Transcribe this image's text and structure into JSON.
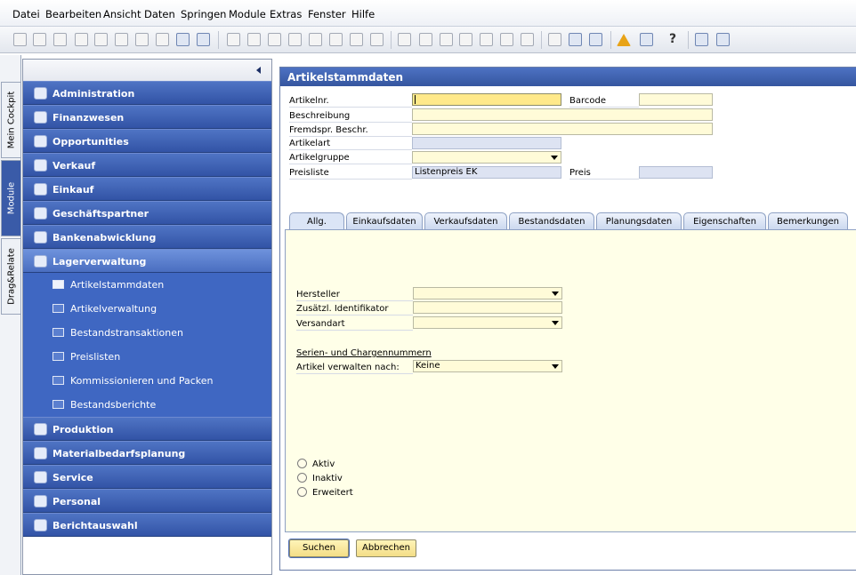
{
  "menu": [
    "Datei",
    "Bearbeiten",
    "Ansicht",
    "Daten",
    "Springen",
    "Module",
    "Extras",
    "Fenster",
    "Hilfe"
  ],
  "toolbar": {
    "icons": [
      "print-preview-icon",
      "print-icon",
      "send-icon",
      "excel-icon",
      "word-icon",
      "pdf-icon",
      "layout-icon",
      "navigate-icon",
      "lock-icon",
      "find-icon",
      "add-icon",
      "first-record-icon",
      "previous-record-icon",
      "next-record-icon",
      "last-record-icon",
      "filter-icon",
      "sort-icon",
      "base-document-icon",
      "target-document-icon",
      "relationship-map-icon",
      "payment-icon",
      "gross-profit-icon",
      "settlement-icon",
      "journal-icon",
      "edit-icon",
      "query-icon",
      "query-manager-icon",
      "alerts-icon",
      "calendar-icon",
      "help-icon",
      "form-settings-icon",
      "drag-relate-icon"
    ],
    "help_glyph": "?"
  },
  "side_tabs": [
    "Mein Cockpit",
    "Module",
    "Drag&Relate"
  ],
  "nav": {
    "modules_top": [
      "Administration",
      "Finanzwesen",
      "Opportunities",
      "Verkauf",
      "Einkauf",
      "Geschäftspartner",
      "Bankenabwicklung",
      "Lagerverwaltung"
    ],
    "sub_items": [
      "Artikelstammdaten",
      "Artikelverwaltung",
      "Bestandstransaktionen",
      "Preislisten",
      "Kommissionieren und Packen",
      "Bestandsberichte"
    ],
    "modules_bottom": [
      "Produktion",
      "Materialbedarfsplanung",
      "Service",
      "Personal",
      "Berichtauswahl"
    ]
  },
  "window": {
    "title": "Artikelstammdaten",
    "labels": {
      "item_no": "Artikelnr.",
      "barcode": "Barcode",
      "description": "Beschreibung",
      "foreign_description": "Fremdspr. Beschr.",
      "item_type": "Artikelart",
      "item_group": "Artikelgruppe",
      "price_list": "Preisliste",
      "price": "Preis"
    },
    "values": {
      "item_no": "",
      "barcode": "",
      "description": "",
      "foreign_description": "",
      "item_type": "",
      "item_group": "",
      "price_list": "Listenpreis EK",
      "price": ""
    },
    "tabs": [
      "Allg.",
      "Einkaufsdaten",
      "Verkaufsdaten",
      "Bestandsdaten",
      "Planungsdaten",
      "Eigenschaften",
      "Bemerkungen"
    ],
    "general": {
      "manufacturer_label": "Hersteller",
      "manufacturer_value": "",
      "additional_id_label": "Zusätzl. Identifikator",
      "additional_id_value": "",
      "shipping_label": "Versandart",
      "shipping_value": "",
      "serial_heading": "Serien- und Chargennummern",
      "manage_by_label": "Artikel verwalten nach:",
      "manage_by_value": "Keine",
      "status_options": [
        "Aktiv",
        "Inaktiv",
        "Erweitert"
      ]
    },
    "buttons": {
      "search": "Suchen",
      "cancel": "Abbrechen"
    }
  },
  "colors": {
    "nav_module": "#3253a6",
    "nav_sub": "#3f67c2",
    "field_bg": "#fffbd8",
    "field_focus": "#ffe98a",
    "panel_bg": "#ffffe8"
  }
}
